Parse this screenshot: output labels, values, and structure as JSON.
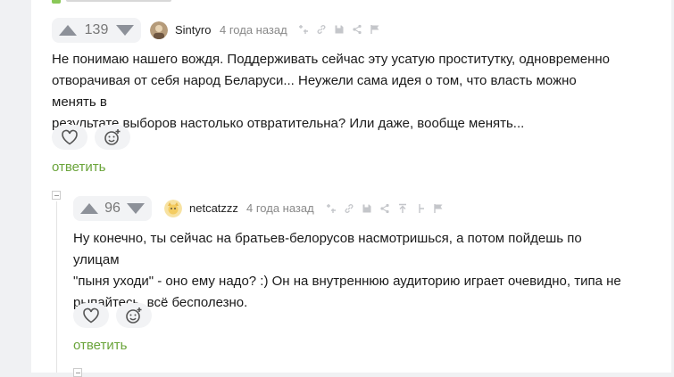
{
  "comments": [
    {
      "rating": "139",
      "author": "Sintyro",
      "time": "4 года назад",
      "text_lines": [
        "Не понимаю нашего вождя. Поддерживать сейчас эту усатую проститутку, одновременно",
        "отворачивая от себя народ Беларуси... Неужели сама идея о том, что власть можно менять в",
        "результате выборов настолько отвратительна? Или даже, вообще менять..."
      ],
      "reply_label": "ответить"
    },
    {
      "rating": "96",
      "author": "netcatzzz",
      "time": "4 года назад",
      "text_lines": [
        "Ну конечно, ты сейчас на братьев-белорусов насмотришься, а потом пойдешь по улицам",
        "\"пыня уходи\" - оно ему надо? :) Он на внутреннюю аудиторию играет очевидно, типа не",
        "рыпайтесь, всё бесполезно."
      ],
      "reply_label": "ответить"
    }
  ],
  "colors": {
    "accent_green": "#6aa43a",
    "icon_gray": "#8d9199",
    "page_bg": "#f0f1f3"
  },
  "icons": [
    "upvote-icon",
    "downvote-icon",
    "share-icon",
    "link-icon",
    "save-icon",
    "flag-icon",
    "heart-icon",
    "emoji-add-icon"
  ]
}
